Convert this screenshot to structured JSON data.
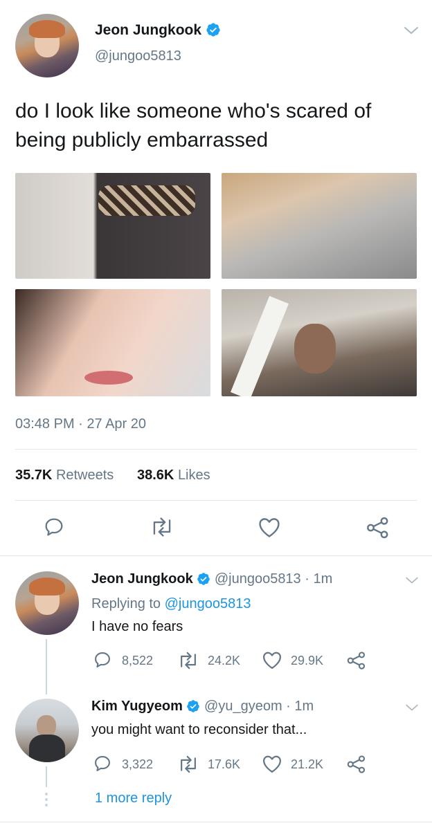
{
  "tweet": {
    "author_name": "Jeon Jungkook",
    "author_handle": "@jungoo5813",
    "text_line1": "do I look like someone who's scared of",
    "text_line2": "being publicly embarrassed",
    "timestamp": "03:48 PM · 27 Apr 20",
    "retweet_count": "35.7K",
    "retweet_label": "Retweets",
    "like_count": "38.6K",
    "like_label": "Likes"
  },
  "replies": [
    {
      "author_name": "Jeon Jungkook",
      "author_handle": "@jungoo5813",
      "time": "· 1m",
      "replying_prefix": "Replying to",
      "replying_to": "@jungoo5813",
      "text": "I have no fears",
      "reply_count": "8,522",
      "retweet_count": "24.2K",
      "like_count": "29.9K"
    },
    {
      "author_name": "Kim Yugyeom",
      "author_handle": "@yu_gyeom",
      "time": "· 1m",
      "text": "you might want to reconsider that...",
      "reply_count": "3,322",
      "retweet_count": "17.6K",
      "like_count": "21.2K"
    }
  ],
  "more_replies": "1 more reply",
  "colors": {
    "accent": "#1b95e0",
    "muted": "#657786",
    "text": "#14171a",
    "divider": "#e1e8ed"
  },
  "icons": [
    "verified-icon",
    "chevron-down-icon",
    "reply-icon",
    "retweet-icon",
    "like-icon",
    "share-icon"
  ]
}
